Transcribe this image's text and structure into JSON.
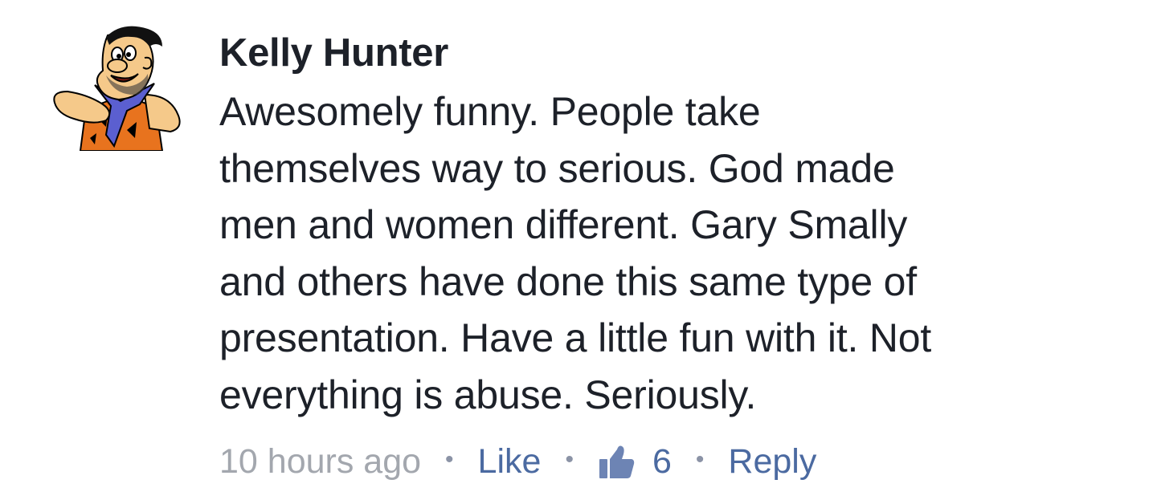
{
  "comment": {
    "author": "Kelly Hunter",
    "avatar_icon": "cartoon-caveman-avatar-icon",
    "body_lines": [
      "Awesomely funny. People take",
      "themselves way to serious. God made",
      "men and women different. Gary Smally",
      "and others have done this same type of",
      "presentation. Have a little fun with it. Not",
      "everything is abuse. Seriously."
    ],
    "timestamp": "10 hours ago",
    "separator": "•",
    "like_label": "Like",
    "like_icon": "thumbs-up-icon",
    "like_count": "6",
    "reply_label": "Reply"
  },
  "colors": {
    "text": "#1d2129",
    "meta_gray": "#a3a7ae",
    "link_blue": "#4b6aa1",
    "thumb_blue": "#6d84b4"
  }
}
